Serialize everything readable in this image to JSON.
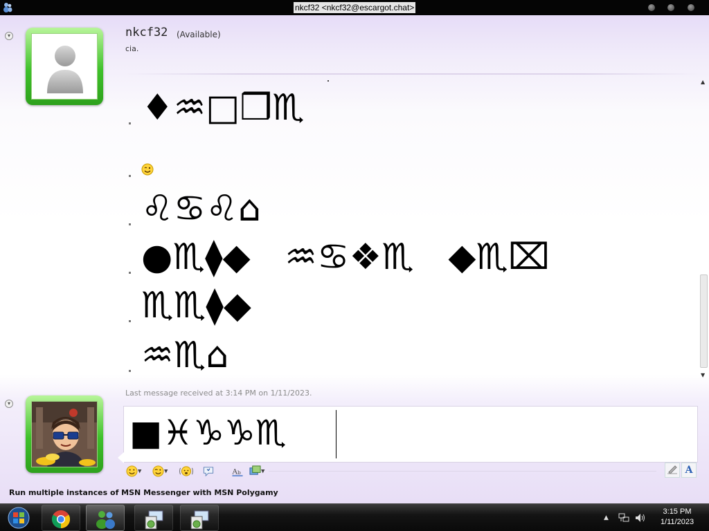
{
  "window": {
    "title": "nkcf32 <nkcf32@escargot.chat>"
  },
  "contact": {
    "name": "nkcf32",
    "status": "(Available)",
    "personal_message": "cia."
  },
  "conversation": {
    "messages": [
      {
        "text": "♦♒□❒♏",
        "type": "text"
      },
      {
        "text": "",
        "type": "emoticon",
        "icon": "winking-smiley-icon"
      },
      {
        "text": "♌♋♌⌂",
        "type": "text"
      },
      {
        "text": "●♏⧫◆   ♒♋❖♏   ◆♏⌧",
        "type": "text"
      },
      {
        "text": "♏♏⧫◆",
        "type": "text"
      },
      {
        "text": "♒♏⌂",
        "type": "text"
      }
    ],
    "last_message_info": "Last message received at 3:14 PM on 1/11/2023."
  },
  "compose": {
    "text": "■♓♑♑♏"
  },
  "toolbar": {
    "emoticons_icon": "smiley-icon",
    "winks_icon": "wink-icon",
    "nudge_icon": "nudge-icon",
    "voice_clip_icon": "voice-clip-icon",
    "font_icon": "font-icon",
    "background_icon": "background-icon",
    "handwriting_icon": "handwriting-icon",
    "text_icon": "text-icon"
  },
  "ad": {
    "text": "Run multiple instances of MSN Messenger with MSN Polygamy"
  },
  "taskbar": {
    "apps": [
      "start-orb-icon",
      "chrome-icon",
      "messenger-icon",
      "remote-desktop-icon",
      "remote-desktop-icon"
    ],
    "clock_time": "3:15 PM",
    "clock_date": "1/11/2023"
  },
  "colors": {
    "avatar_frame": "#3fc12b",
    "window_bg": "#e6dcf7"
  }
}
